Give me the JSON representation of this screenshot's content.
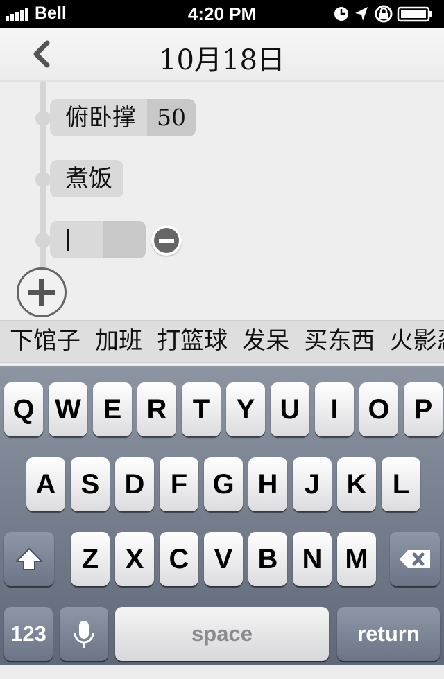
{
  "status_bar": {
    "carrier": "Bell",
    "time": "4:20 PM"
  },
  "header": {
    "title": "10月18日"
  },
  "timeline": {
    "items": [
      {
        "label": "俯卧撑",
        "quantity": "50"
      },
      {
        "label": "煮饭"
      }
    ],
    "input": {
      "value": ""
    }
  },
  "suggestions": [
    "下馆子",
    "加班",
    "打篮球",
    "发呆",
    "买东西",
    "火影忍"
  ],
  "keyboard": {
    "row1": [
      "Q",
      "W",
      "E",
      "R",
      "T",
      "Y",
      "U",
      "I",
      "O",
      "P"
    ],
    "row2": [
      "A",
      "S",
      "D",
      "F",
      "G",
      "H",
      "J",
      "K",
      "L"
    ],
    "row3": [
      "Z",
      "X",
      "C",
      "V",
      "B",
      "N",
      "M"
    ],
    "numbers_label": "123",
    "space_label": "space",
    "return_label": "return"
  }
}
